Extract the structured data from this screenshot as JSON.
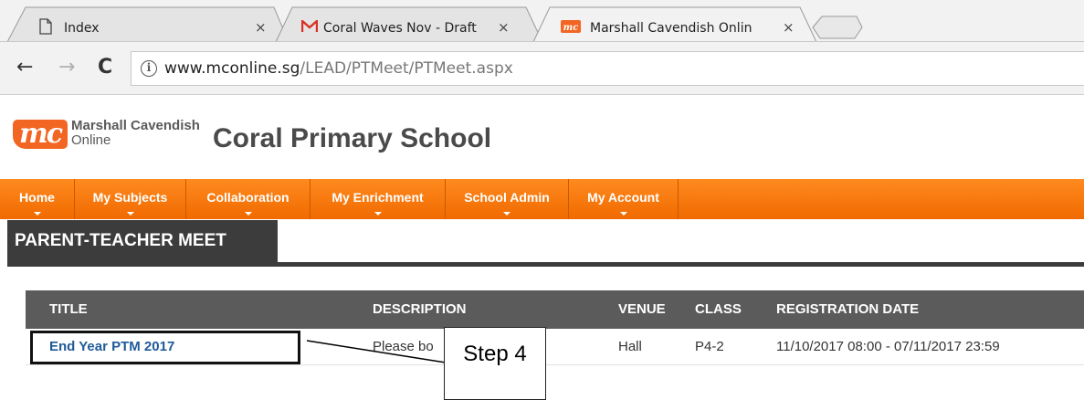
{
  "browser": {
    "tabs": [
      {
        "label": "Index",
        "icon": "page-icon",
        "close": "×"
      },
      {
        "label": "Coral Waves Nov - Draft",
        "icon": "gmail-icon",
        "close": "×"
      },
      {
        "label": "Marshall Cavendish Onlin",
        "icon": "mc-favicon",
        "close": "×"
      }
    ],
    "nav": {
      "back": "←",
      "forward": "→",
      "reload": "C"
    },
    "url_host": "www.mconline.sg",
    "url_path": "/LEAD/PTMeet/PTMeet.aspx",
    "info_glyph": "i"
  },
  "site": {
    "logo_mark": "mc",
    "logo_line1": "Marshall Cavendish",
    "logo_line2": "Online",
    "school_name": "Coral Primary School",
    "brand_color": "#f26522"
  },
  "nav": {
    "items": [
      "Home",
      "My Subjects",
      "Collaboration",
      "My Enrichment",
      "School Admin",
      "My Account"
    ]
  },
  "page": {
    "section_title": "PARENT-TEACHER MEET"
  },
  "table": {
    "headers": [
      "TITLE",
      "DESCRIPTION",
      "VENUE",
      "CLASS",
      "REGISTRATION DATE"
    ],
    "rows": [
      {
        "title": "End Year PTM 2017",
        "description": "Please bo",
        "venue": "Hall",
        "class": "P4-2",
        "registration": "11/10/2017 08:00 - 07/11/2017 23:59"
      }
    ]
  },
  "annotation": {
    "step_label": "Step 4"
  }
}
